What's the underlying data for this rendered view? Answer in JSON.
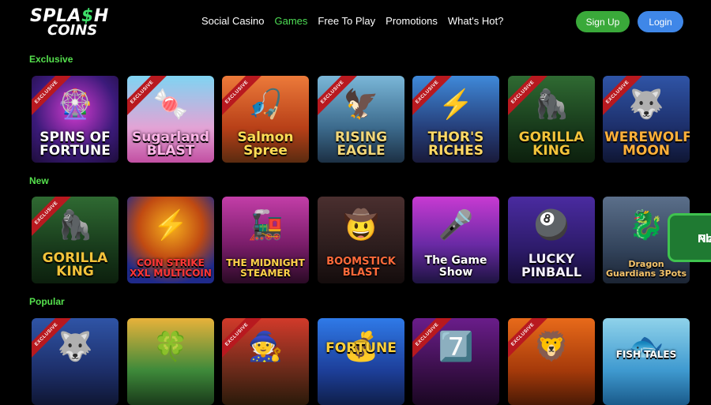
{
  "header": {
    "logo_top": "SPLA",
    "logo_dollar": "$",
    "logo_top_end": "H",
    "logo_bottom": "COINS",
    "nav": [
      {
        "label": "Social Casino"
      },
      {
        "label": "Games"
      },
      {
        "label": "Free To Play"
      },
      {
        "label": "Promotions"
      },
      {
        "label": "What's Hot?"
      }
    ],
    "signup_label": "Sign Up",
    "login_label": "Login"
  },
  "sections": {
    "exclusive": "Exclusive",
    "new": "New",
    "popular": "Popular"
  },
  "exclusive_games": [
    {
      "title": "SPINS OF FORTUNE",
      "badge": "EXCLUSIVE"
    },
    {
      "title": "Sugarland BLAST",
      "badge": "EXCLUSIVE"
    },
    {
      "title": "Salmon Spree",
      "badge": "EXCLUSIVE"
    },
    {
      "title": "RISING EAGLE",
      "badge": "EXCLUSIVE"
    },
    {
      "title": "THOR'S RICHES",
      "badge": "EXCLUSIVE"
    },
    {
      "title": "GORILLA KING",
      "badge": "EXCLUSIVE"
    },
    {
      "title": "WEREWOLF MOON",
      "badge": "EXCLUSIVE"
    }
  ],
  "new_games": [
    {
      "title": "GORILLA KING",
      "badge": "EXCLUSIVE"
    },
    {
      "title": "COIN STRIKE XXL MULTICOIN"
    },
    {
      "title": "THE MIDNIGHT STEAMER"
    },
    {
      "title": "BOOMSTICK BLAST"
    },
    {
      "title": "The Game Show"
    },
    {
      "title": "LUCKY PINBALL"
    },
    {
      "title": "Dragon Guardians 3Pots"
    }
  ],
  "popular_games": [
    {
      "title": "",
      "badge": "EXCLUSIVE"
    },
    {
      "title": ""
    },
    {
      "title": "",
      "badge": "EXCLUSIVE"
    },
    {
      "title": "FORTUNE"
    },
    {
      "title": "",
      "badge": "EXCLUSIVE"
    },
    {
      "title": "",
      "badge": "EXCLUSIVE"
    },
    {
      "title": "FISH TALES"
    }
  ],
  "play_now": {
    "line1": "Play",
    "line2": "Now"
  },
  "colors": {
    "accent_green": "#4ede55",
    "signup": "#3aa93a",
    "login": "#3f87e8",
    "badge_red": "#b8191f"
  }
}
